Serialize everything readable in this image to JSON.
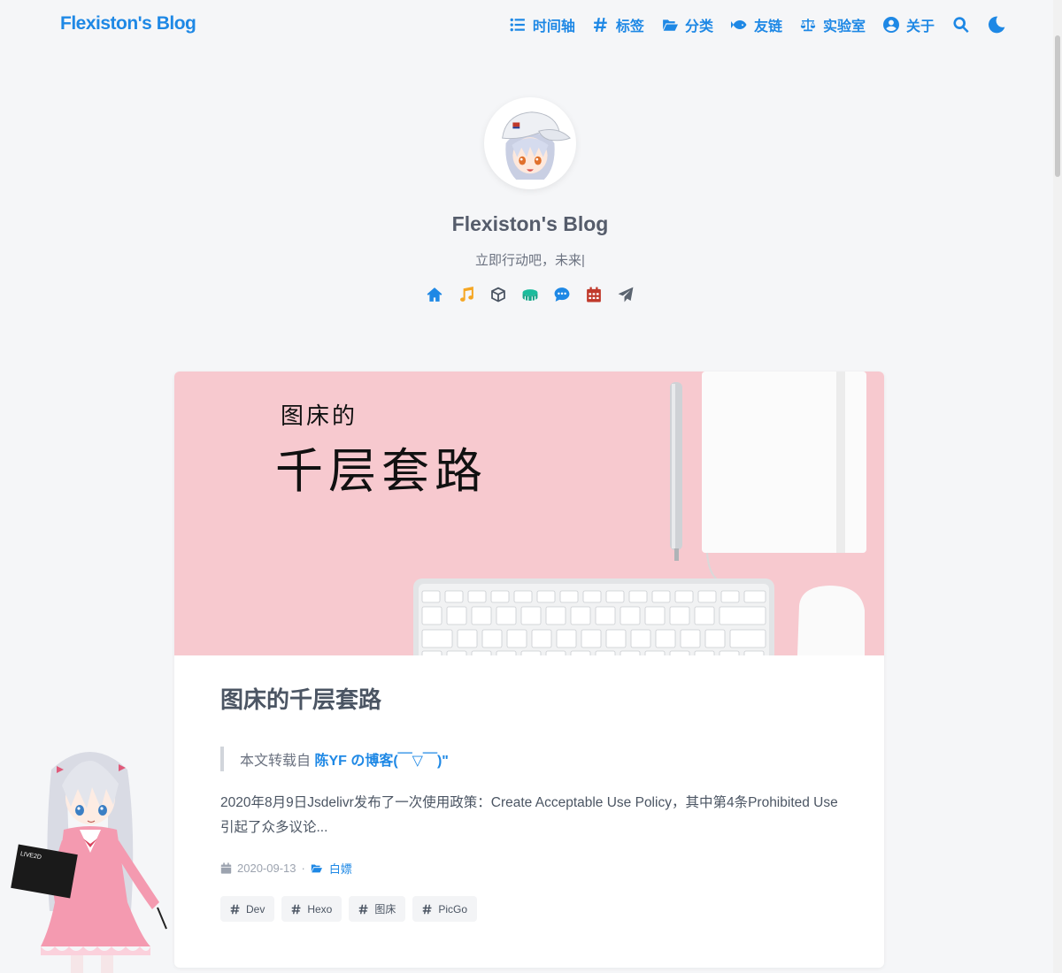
{
  "brand": "Flexiston's Blog",
  "nav": {
    "items": [
      {
        "label": "时间轴",
        "icon": "list-icon"
      },
      {
        "label": "标签",
        "icon": "hashtag-icon"
      },
      {
        "label": "分类",
        "icon": "folder-open-icon"
      },
      {
        "label": "友链",
        "icon": "fish-icon"
      },
      {
        "label": "实验室",
        "icon": "balance-scale-icon"
      },
      {
        "label": "关于",
        "icon": "user-circle-icon"
      }
    ],
    "search_icon": "search-icon",
    "theme_icon": "moon-icon"
  },
  "hero": {
    "title": "Flexiston's Blog",
    "subtitle": "立即行动吧，未来|",
    "social_icons": [
      {
        "name": "home-icon",
        "color": "#1e88e5"
      },
      {
        "name": "music-icon",
        "color": "#f5a623"
      },
      {
        "name": "cube-icon",
        "color": "#4b5563"
      },
      {
        "name": "drum-icon",
        "color": "#1abc9c"
      },
      {
        "name": "comment-dots-icon",
        "color": "#1e88e5"
      },
      {
        "name": "calendar-icon",
        "color": "#c0392b"
      },
      {
        "name": "paper-plane-icon",
        "color": "#5b6470"
      }
    ]
  },
  "post": {
    "cover_line1": "图床的",
    "cover_line2": "千层套路",
    "title": "图床的千层套路",
    "quote_prefix": "本文转载自 ",
    "quote_link": "陈YF の博客(￣▽￣)\"",
    "excerpt": "2020年8月9日Jsdelivr发布了一次使用政策：Create Acceptable Use Policy，其中第4条Prohibited Use引起了众多议论...",
    "date": "2020-09-13",
    "separator": "·",
    "category": "白嫖",
    "tags": [
      "Dev",
      "Hexo",
      "图床",
      "PicGo"
    ]
  },
  "mascot_badge": "LIVE2D",
  "colors": {
    "accent": "#1e88e5",
    "background": "#f5f6f8",
    "cover_pink": "#f7c9cf"
  }
}
